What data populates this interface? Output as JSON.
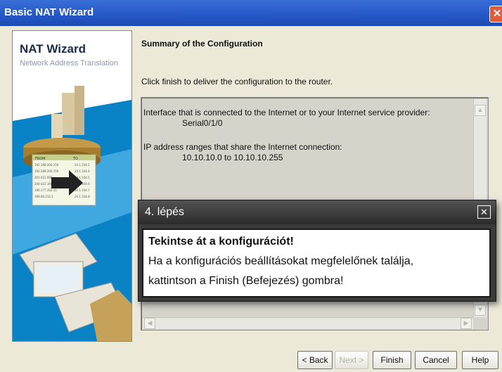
{
  "window": {
    "title": "Basic NAT Wizard",
    "close_symbol": "✕"
  },
  "sidebar": {
    "title": "NAT Wizard",
    "subtitle": "Network Address Translation",
    "table_headers": [
      "FROM",
      "TO"
    ],
    "table_rows": [
      [
        "192.168.200.150",
        "24.1.104.2"
      ],
      [
        "192.168.200.150",
        "24.1.104.4"
      ],
      [
        "201.021.060",
        "24.1.104.5"
      ],
      [
        "204.022.160",
        "24.1.104.6"
      ],
      [
        "196.177.202.15",
        "24.1.104.7"
      ],
      [
        "168.60.232.1",
        "24.1.104.8"
      ]
    ]
  },
  "content": {
    "section_title": "Summary of the Configuration",
    "instruction": "Click finish to deliver the configuration to the router.",
    "summary_lines": [
      "Interface that is connected to the Internet or to your Internet service provider:",
      "Serial0/1/0",
      "IP address ranges that share the Internet connection:",
      "10.10.10.0 to 10.10.10.255"
    ]
  },
  "popup": {
    "title": "4. lépés",
    "close_symbol": "✕",
    "lines": [
      "Tekintse át a konfigurációt!",
      "Ha a konfigurációs beállításokat megfelelőnek találja,",
      "kattintson a Finish (Befejezés) gombra!"
    ]
  },
  "buttons": {
    "back": "< Back",
    "next": "Next >",
    "finish": "Finish",
    "cancel": "Cancel",
    "help": "Help"
  },
  "colors": {
    "titlebar": "#2456c6",
    "popup_header": "#3a3a3a",
    "close_button": "#e35b3a"
  }
}
